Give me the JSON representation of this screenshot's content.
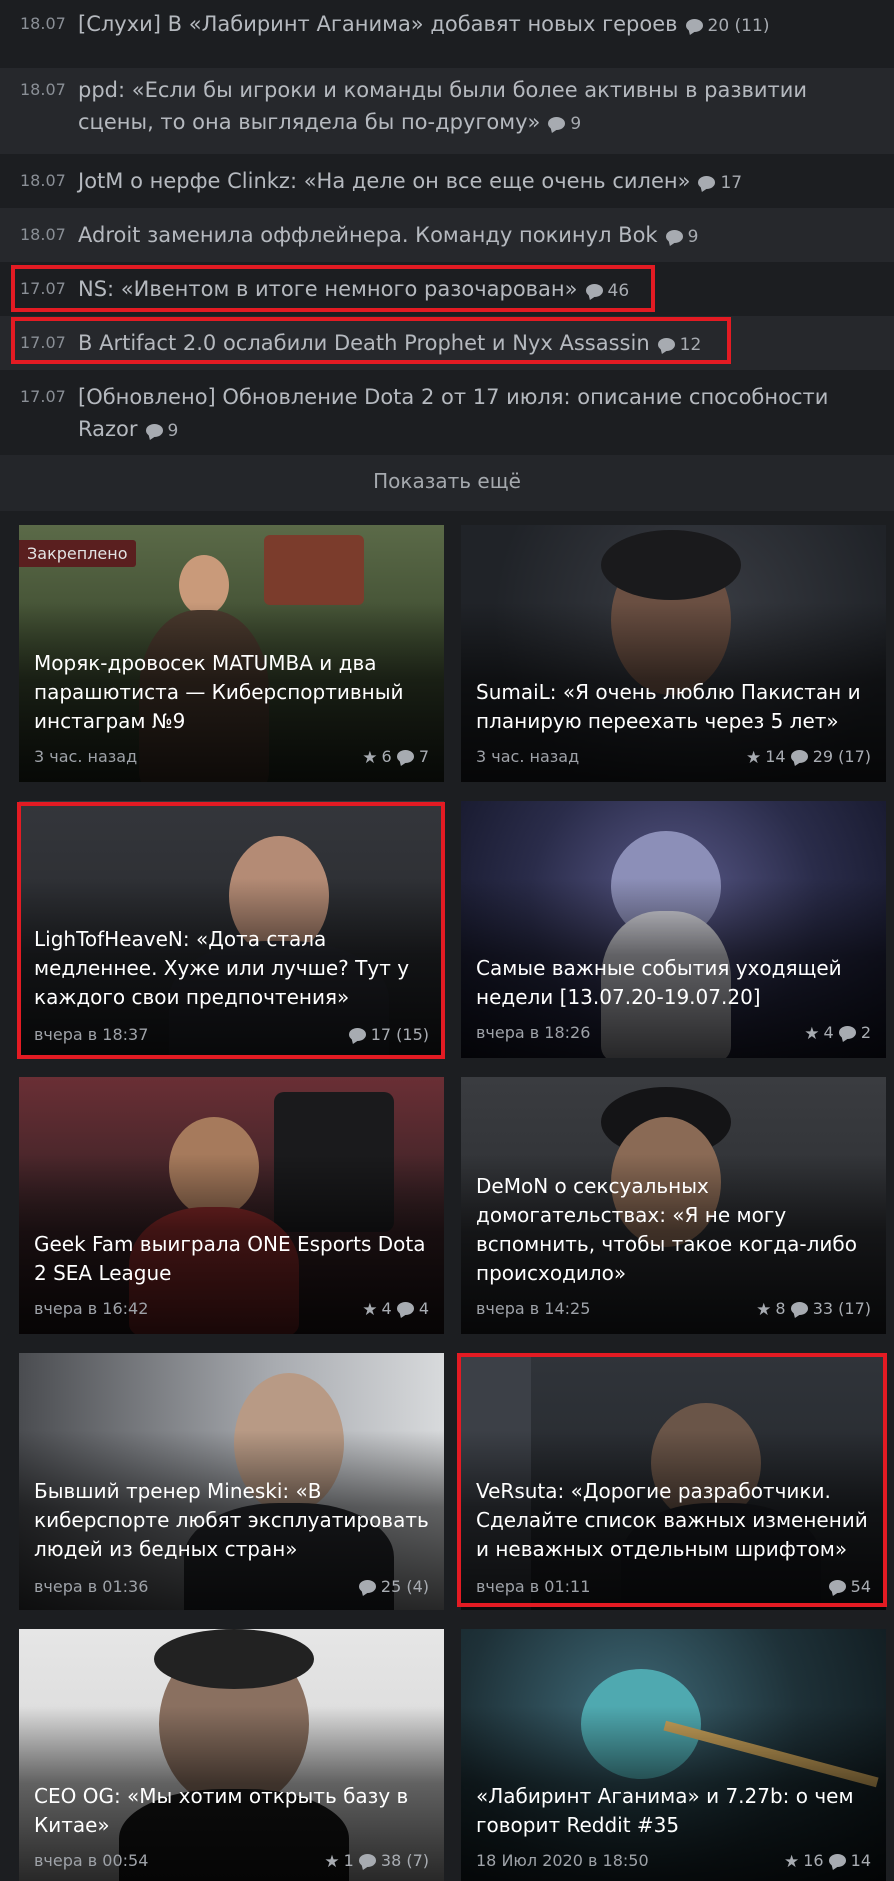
{
  "news": [
    {
      "date": "18.07",
      "title": "[Слухи] В «Лабиринт Аганима» добавят новых героев",
      "comments": "20 (11)"
    },
    {
      "date": "18.07",
      "title": "ppd: «Если бы игроки и команды были более активны в развитии сцены, то она выглядела бы по-другому»",
      "comments": "9"
    },
    {
      "date": "18.07",
      "title": "JotM о нерфе Clinkz: «На деле он все еще очень силен»",
      "comments": "17"
    },
    {
      "date": "18.07",
      "title": "Adroit заменила оффлейнера. Команду покинул Bok",
      "comments": "9"
    },
    {
      "date": "17.07",
      "title": "NS: «Ивентом в итоге немного разочарован»",
      "comments": "46"
    },
    {
      "date": "17.07",
      "title": "В Artifact 2.0 ослабили Death Prophet и Nyx Assassin",
      "comments": "12"
    },
    {
      "date": "17.07",
      "title": "[Обновлено] Обновление Dota 2 от 17 июля: описание способности Razor",
      "comments": "9"
    }
  ],
  "show_more": "Показать ещё",
  "cards": [
    {
      "badge": "Закреплено",
      "title": "Моряк-дровосек MATUMBA и два парашютиста — Киберспортивный инстаграм №9",
      "time": "3 час. назад",
      "stars": "6",
      "comments": "7"
    },
    {
      "title": "SumaiL: «Я очень люблю Пакистан и планирую переехать через 5 лет»",
      "time": "3 час. назад",
      "stars": "14",
      "comments": "29 (17)"
    },
    {
      "title": "LighTofHeaveN: «Дота стала медленнее. Хуже или лучше? Тут у каждого свои предпочтения»",
      "time": "вчера в 18:37",
      "comments": "17 (15)"
    },
    {
      "title": "Самые важные события уходящей недели [13.07.20-19.07.20]",
      "time": "вчера в 18:26",
      "stars": "4",
      "comments": "2"
    },
    {
      "title": "Geek Fam выиграла ONE Esports Dota 2 SEA League",
      "time": "вчера в 16:42",
      "stars": "4",
      "comments": "4"
    },
    {
      "title": "DeMoN о сексуальных домогательствах: «Я не могу вспомнить, чтобы такое когда-либо происходило»",
      "time": "вчера в 14:25",
      "stars": "8",
      "comments": "33 (17)"
    },
    {
      "title": "Бывший тренер Mineski: «В киберспорте любят эксплуатировать людей из бедных стран»",
      "time": "вчера в 01:36",
      "comments": "25 (4)"
    },
    {
      "title": "VeRsuta: «Дорогие разработчики. Сделайте список важных изменений и неважных отдельным шрифтом»",
      "time": "вчера в 01:11",
      "comments": "54"
    },
    {
      "title": "CEO OG: «Мы хотим открыть базу в Китае»",
      "time": "вчера в 00:54",
      "stars": "1",
      "comments": "38 (7)"
    },
    {
      "title": "«Лабиринт Аганима» и 7.27b: о чем говорит Reddit #35",
      "time": "18 Июл 2020 в 18:50",
      "stars": "16",
      "comments": "14"
    }
  ],
  "colors": {
    "highlight": "#e31b23",
    "background": "#1c1e21",
    "badge": "#5a1f1f"
  }
}
